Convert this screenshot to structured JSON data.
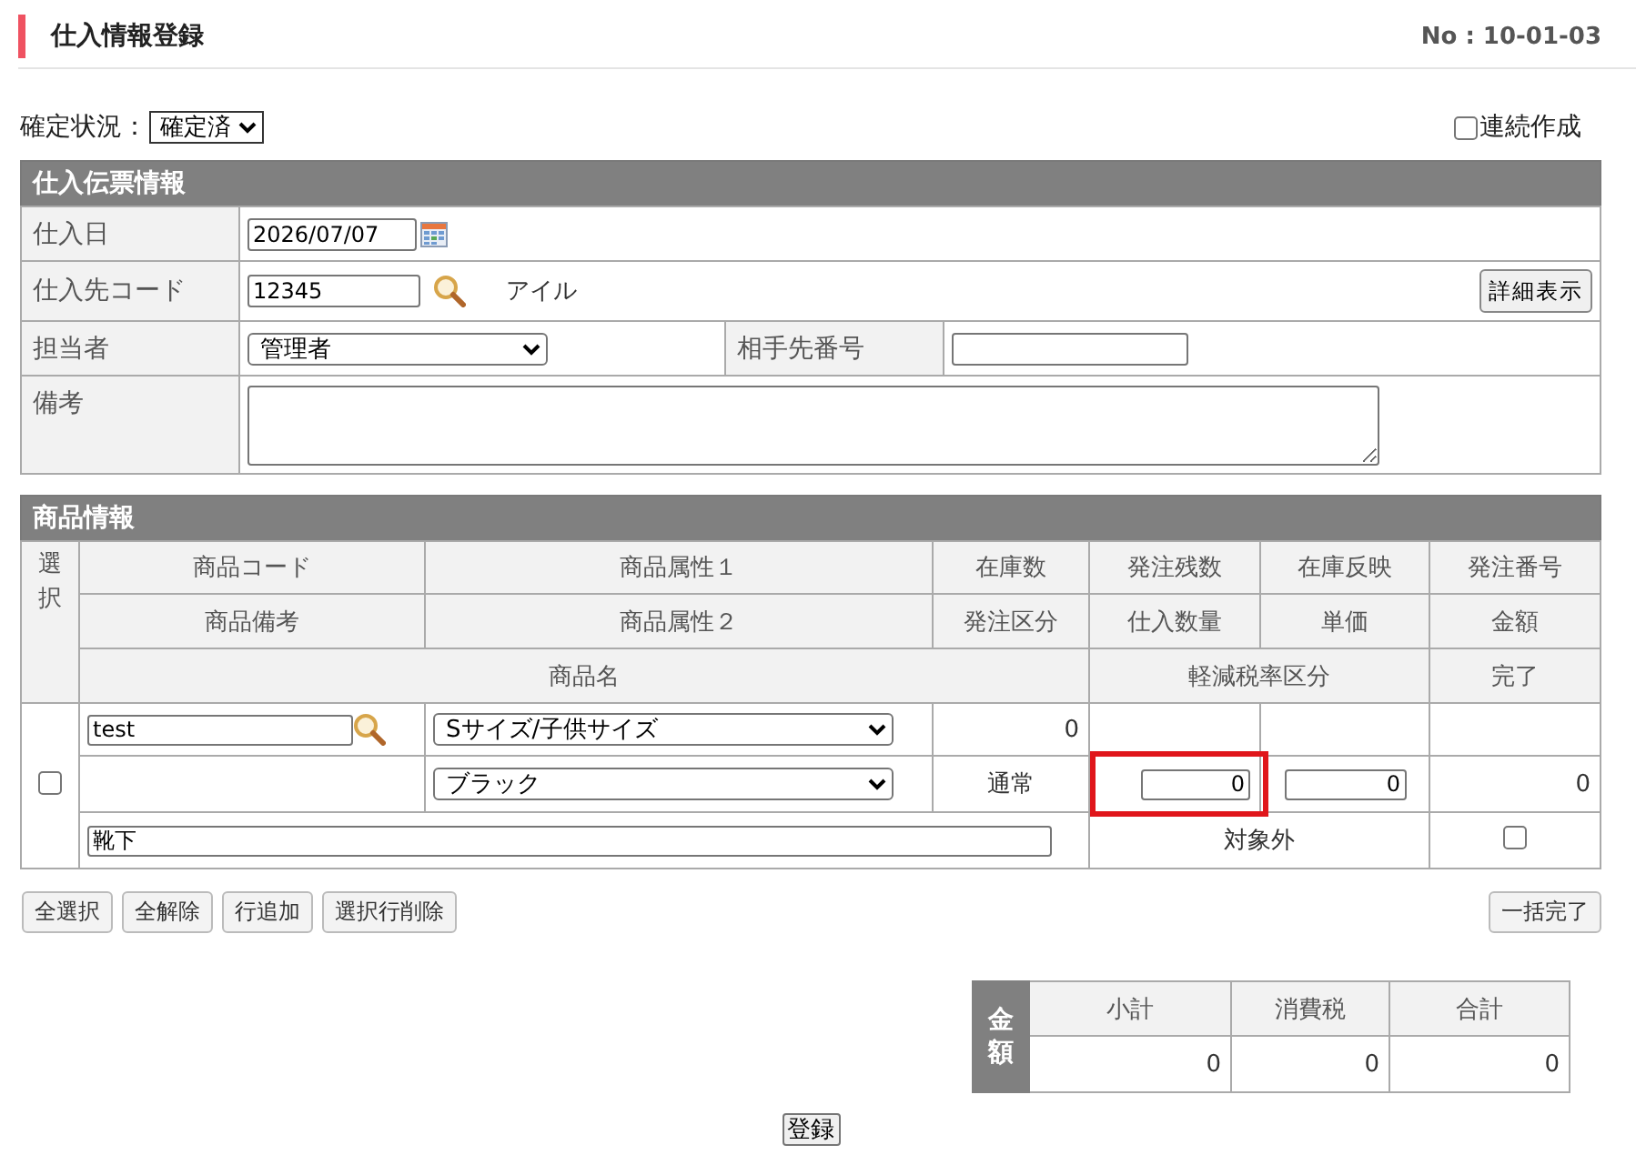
{
  "header": {
    "title": "仕入情報登録",
    "number": "No : 10-01-03"
  },
  "status": {
    "label": "確定状況：",
    "value": "確定済"
  },
  "continuous_create": {
    "label": "連続作成",
    "checked": false
  },
  "slip": {
    "title": "仕入伝票情報",
    "date": {
      "label": "仕入日",
      "value": "2026/07/07"
    },
    "supplier": {
      "label": "仕入先コード",
      "value": "12345",
      "name": "アイル",
      "detail_button": "詳細表示"
    },
    "staff": {
      "label": "担当者",
      "value": "管理者"
    },
    "partner_number": {
      "label": "相手先番号"
    },
    "remarks": {
      "label": "備考"
    }
  },
  "items": {
    "title": "商品情報",
    "select_header": "選択",
    "header_rows": [
      [
        "商品コード",
        "商品属性１",
        "在庫数",
        "発注残数",
        "在庫反映",
        "発注番号"
      ],
      [
        "商品備考",
        "商品属性２",
        "発注区分",
        "仕入数量",
        "単価",
        "金額"
      ],
      [
        "商品名",
        "軽減税率区分",
        "完了"
      ]
    ],
    "rows": [
      {
        "selected": false,
        "code": "test",
        "attribute_1": "Sサイズ/子供サイズ",
        "stock": "0",
        "attribute_2": "ブラック",
        "order_type": "通常",
        "quantity": {
          "value": "0",
          "highlighted": true
        },
        "unit_price": "0",
        "amount": "0",
        "name": "靴下",
        "tax_type": "対象外",
        "completed": false
      }
    ]
  },
  "row_buttons": [
    "全選択",
    "全解除",
    "行追加",
    "選択行削除"
  ],
  "bulk_complete_button": "一括完了",
  "totals": {
    "label": "金額",
    "columns": [
      "小計",
      "消費税",
      "合計"
    ],
    "values": [
      "0",
      "0",
      "0"
    ]
  },
  "submit_button": "登録"
}
